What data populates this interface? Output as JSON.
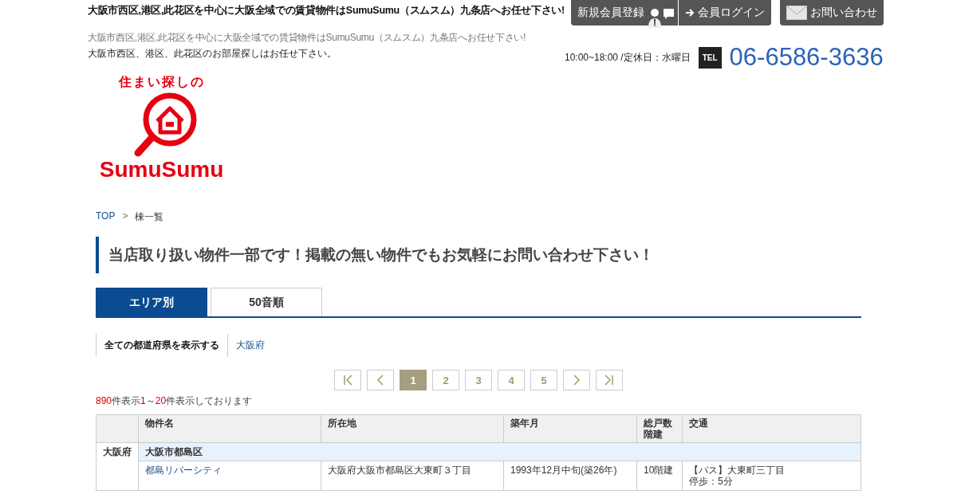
{
  "header": {
    "tagline": "大阪市西区,港区,此花区を中心に大阪全域での賃貸物件はSumuSumu（スムスム）九条店へお任せ下さい!",
    "subline": "大阪市西区,港区,此花区を中心に大阪全域での賃貸物件はSumuSumu（スムスム）九条店へお任せ下さい!",
    "lead": "大阪市西区、港区、此花区のお部屋探しはお任せ下さい。",
    "buttons": [
      {
        "kind": "register",
        "label": "新規会員登録"
      },
      {
        "kind": "login",
        "label": "会員ログイン"
      },
      {
        "kind": "contact",
        "label": "お問い合わせ"
      }
    ],
    "hours": "10:00~18:00 /定休日：水曜日",
    "tel_badge": "TEL",
    "phone": "06-6586-3636"
  },
  "logo": {
    "top_text": "住まい探しの",
    "brand": "SumuSumu"
  },
  "breadcrumb": [
    {
      "label": "TOP",
      "link": true
    },
    {
      "label": "棟一覧",
      "link": false
    }
  ],
  "breadcrumb_separator": ">",
  "heading": "当店取り扱い物件一部です！掲載の無い物件でもお気軽にお問い合わせ下さい！",
  "tabs": [
    {
      "label": "エリア別",
      "selected": true
    },
    {
      "label": "50音順",
      "selected": false
    }
  ],
  "filters": [
    {
      "label": "全ての都道府県を表示する",
      "selected": true
    },
    {
      "label": "大阪府",
      "selected": false
    }
  ],
  "pagination": [
    {
      "kind": "first"
    },
    {
      "kind": "prev"
    },
    {
      "kind": "page",
      "label": "1",
      "selected": true
    },
    {
      "kind": "page",
      "label": "2",
      "selected": false
    },
    {
      "kind": "page",
      "label": "3",
      "selected": false
    },
    {
      "kind": "page",
      "label": "4",
      "selected": false
    },
    {
      "kind": "page",
      "label": "5",
      "selected": false
    },
    {
      "kind": "next"
    },
    {
      "kind": "last"
    }
  ],
  "result_count": [
    {
      "text": "890",
      "highlight": true
    },
    {
      "text": "件表示",
      "highlight": false
    },
    {
      "text": "1",
      "highlight": true
    },
    {
      "text": "～",
      "highlight": false
    },
    {
      "text": "20",
      "highlight": true
    },
    {
      "text": "件表示しております",
      "highlight": false
    }
  ],
  "table": {
    "columns": [
      "物件名",
      "所在地",
      "築年月",
      "総戸数階建",
      "交通"
    ],
    "prefecture": "大阪府",
    "group": "大阪市都島区",
    "rows": [
      {
        "name": "都島リバーシティ",
        "address": "大阪府大阪市都島区大東町３丁目",
        "built": "1993年12月中旬(築26年)",
        "floors": "10階建",
        "access": [
          "【バス】大東町三丁目",
          "停歩：5分"
        ]
      }
    ]
  }
}
